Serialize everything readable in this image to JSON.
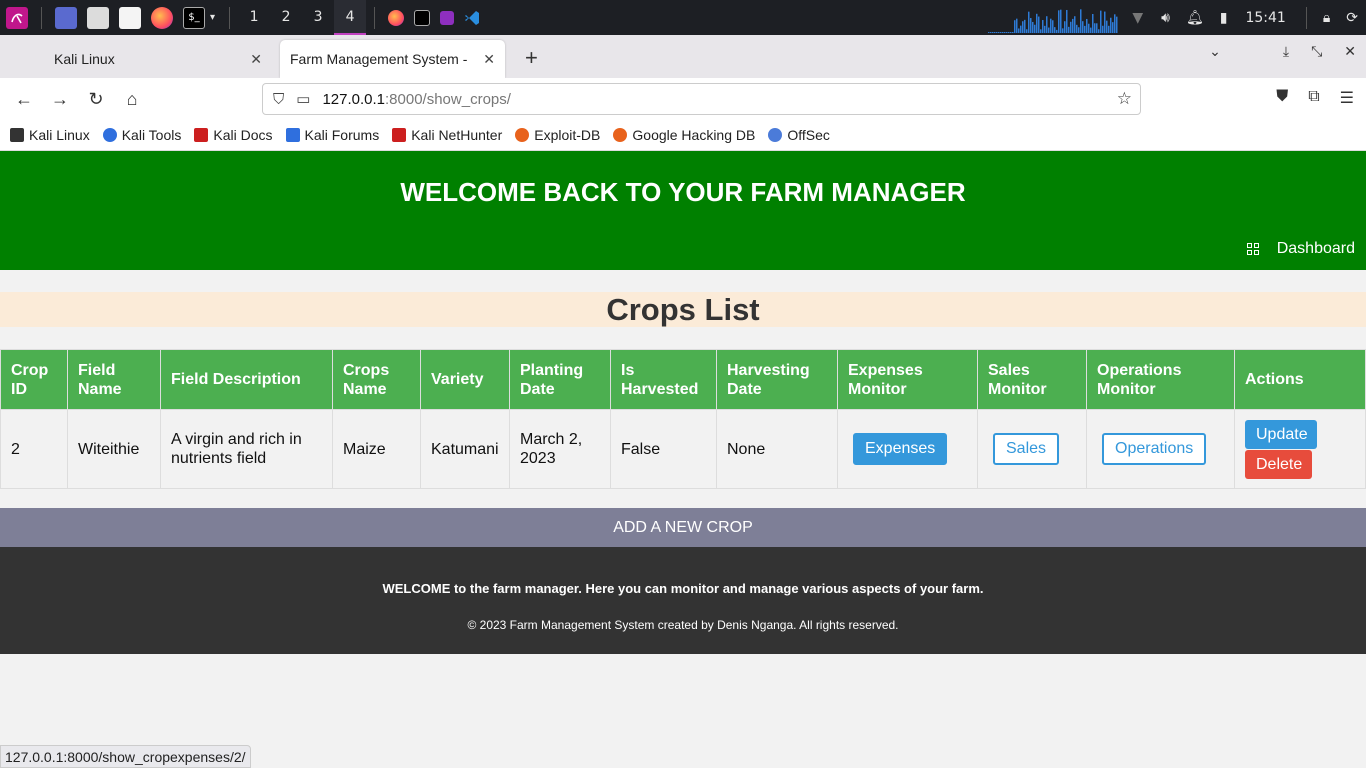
{
  "taskbar": {
    "workspaces": [
      "1",
      "2",
      "3",
      "4"
    ],
    "time": "15:41",
    "accent": "#c040c0"
  },
  "tabs": [
    {
      "title": "Kali Linux",
      "close": "✕"
    },
    {
      "title": "Farm Management System -",
      "close": "✕"
    }
  ],
  "new_tab": "+",
  "url": {
    "host": "127.0.0.1",
    "path": ":8000/show_crops/"
  },
  "bookmarks": [
    {
      "label": "Kali Linux",
      "color": "#333333"
    },
    {
      "label": "Kali Tools",
      "color": "#2f6fde"
    },
    {
      "label": "Kali Docs",
      "color": "#cc1f1f"
    },
    {
      "label": "Kali Forums",
      "color": "#2f6fde"
    },
    {
      "label": "Kali NetHunter",
      "color": "#cc1f1f"
    },
    {
      "label": "Exploit-DB",
      "color": "#e8621c"
    },
    {
      "label": "Google Hacking DB",
      "color": "#e8621c"
    },
    {
      "label": "OffSec",
      "color": "#4b7bd9"
    }
  ],
  "page": {
    "header_title": "WELCOME BACK TO YOUR FARM MANAGER",
    "dashboard_link": "Dashboard",
    "list_title": "Crops List",
    "columns": [
      "Crop ID",
      "Field Name",
      "Field Description",
      "Crops Name",
      "Variety",
      "Planting Date",
      "Is Harvested",
      "Harvesting Date",
      "Expenses Monitor",
      "Sales Monitor",
      "Operations Monitor",
      "Actions"
    ],
    "rows": [
      {
        "crop_id": "2",
        "field_name": "Witeithie",
        "field_description": "A virgin and rich in nutrients field",
        "crops_name": "Maize",
        "variety": "Katumani",
        "planting_date": "March 2, 2023",
        "is_harvested": "False",
        "harvesting_date": "None",
        "expenses_btn": "Expenses",
        "sales_btn": "Sales",
        "operations_btn": "Operations",
        "update_btn": "Update",
        "delete_btn": "Delete"
      }
    ],
    "add_crop": "ADD A NEW CROP",
    "footer_welcome": "WELCOME to the farm manager. Here you can monitor and manage various aspects of your farm.",
    "footer_copy": "© 2023 Farm Management System created by Denis Nganga. All rights reserved.",
    "colors": {
      "header": "#008000",
      "table_header": "#4caf50",
      "button_blue": "#3498db",
      "button_red": "#e74c3c",
      "add_bar": "#7e7f97",
      "footer": "#333333"
    }
  },
  "status_url": "127.0.0.1:8000/show_cropexpenses/2/"
}
